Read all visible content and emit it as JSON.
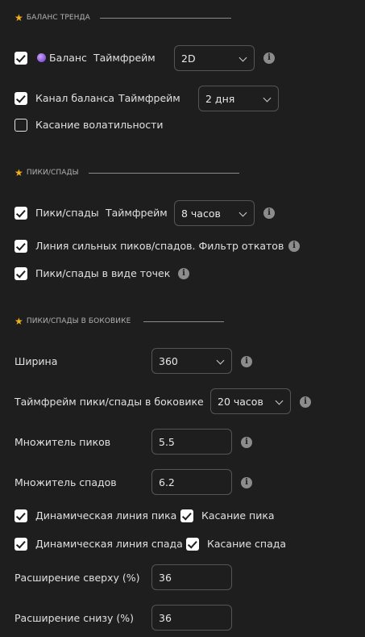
{
  "sections": {
    "balance_trend": {
      "title": "БАЛАНС ТРЕНДА"
    },
    "peaks": {
      "title": "ПИКИ/СПАДЫ"
    },
    "sideways": {
      "title": "ПИКИ/СПАДЫ В БОКОВИКЕ"
    }
  },
  "balance": {
    "label": "Баланс",
    "timeframe_label": "Таймфрейм",
    "timeframe_value": "2D",
    "checked": true
  },
  "balance_channel": {
    "label": "Канал баланса",
    "timeframe_label": "Таймфрейм",
    "timeframe_value": "2 дня",
    "checked": true
  },
  "volatility_touch": {
    "label": "Касание волатильности",
    "checked": false
  },
  "peaks_row": {
    "label": "Пики/спады",
    "timeframe_label": "Таймфрейм",
    "timeframe_value": "8 часов",
    "checked": true
  },
  "strong_line": {
    "label": "Линия сильных пиков/спадов. Фильтр откатов",
    "checked": true
  },
  "dots": {
    "label": "Пики/спады в виде точек",
    "checked": true
  },
  "sideways": {
    "width_label": "Ширина",
    "width_value": "360",
    "tf_label": "Таймфрейм пики/спады в боковике",
    "tf_value": "20 часов",
    "peak_mult_label": "Множитель пиков",
    "peak_mult_value": "5.5",
    "trough_mult_label": "Множитель спадов",
    "trough_mult_value": "6.2",
    "dyn_peak_label": "Динамическая линия пика",
    "peak_touch_label": "Касание пика",
    "dyn_trough_label": "Динамическая линия спада",
    "trough_touch_label": "Касание спада",
    "ext_top_label": "Расширение сверху (%)",
    "ext_top_value": "36",
    "ext_bottom_label": "Расширение снизу (%)",
    "ext_bottom_value": "36"
  },
  "icons": {
    "star": "star-icon",
    "info": "info-icon",
    "chevron": "chevron-down-icon",
    "purple_dot": "purple-circle-icon"
  },
  "colors": {
    "background": "#1e1e1e",
    "star": "#f2b21c",
    "checkbox": "#ffffff",
    "info": "#8c8c8c"
  }
}
